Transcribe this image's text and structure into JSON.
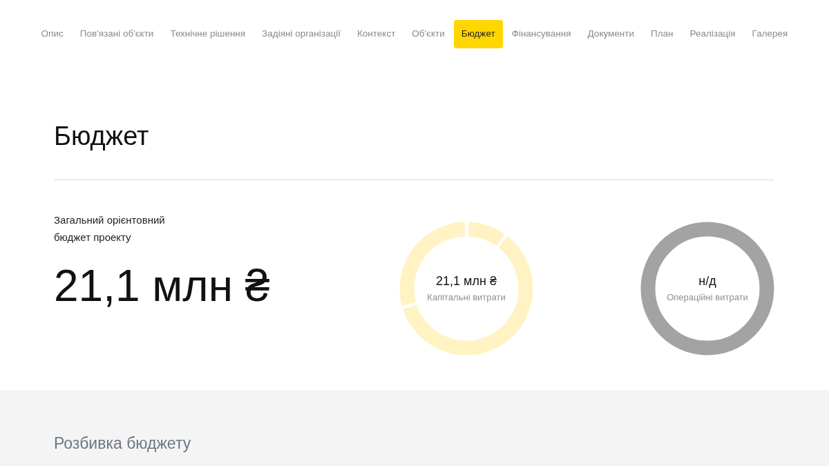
{
  "nav": [
    {
      "label": "Опис",
      "selected": false
    },
    {
      "label": "Пов'язані об'єкти",
      "selected": false
    },
    {
      "label": "Технічне рішення",
      "selected": false
    },
    {
      "label": "Задіяні організації",
      "selected": false
    },
    {
      "label": "Контекст",
      "selected": false
    },
    {
      "label": "Об'єкти",
      "selected": false
    },
    {
      "label": "Бюджет",
      "selected": true
    },
    {
      "label": "Фінансування",
      "selected": false
    },
    {
      "label": "Документи",
      "selected": false
    },
    {
      "label": "План",
      "selected": false
    },
    {
      "label": "Реалізація",
      "selected": false
    },
    {
      "label": "Галерея",
      "selected": false
    }
  ],
  "title": "Бюджет",
  "total": {
    "label": "Загальний орієнтовний бюджет проекту",
    "value": "21,1 млн ₴"
  },
  "donuts": [
    {
      "kind": "segmented",
      "value": "21,1 млн ₴",
      "label": "Капітальні витрати"
    },
    {
      "kind": "empty",
      "value": "н/д",
      "label": "Операційні витрати"
    }
  ],
  "breakdown": {
    "title": "Розбивка бюджету"
  }
}
